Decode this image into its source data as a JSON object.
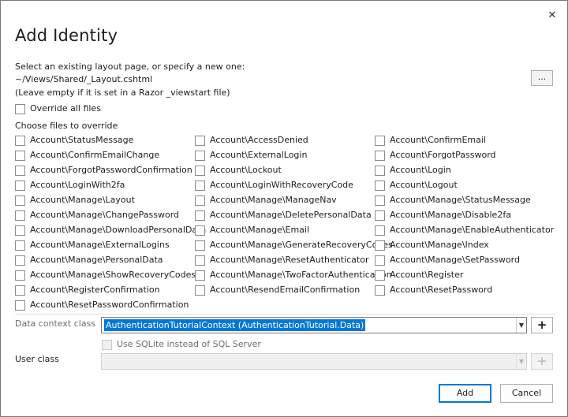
{
  "dialog": {
    "title": "Add Identity",
    "close_glyph": "✕"
  },
  "layout": {
    "prompt": "Select an existing layout page, or specify a new one:",
    "path": "~/Views/Shared/_Layout.cshtml",
    "hint": "(Leave empty if it is set in a Razor _viewstart file)",
    "browse_label": "..."
  },
  "override_all": {
    "label": "Override all files",
    "checked": false
  },
  "choose_files_label": "Choose files to override",
  "files": {
    "col1": [
      "Account\\StatusMessage",
      "Account\\ConfirmEmailChange",
      "Account\\ForgotPasswordConfirmation",
      "Account\\LoginWith2fa",
      "Account\\Manage\\Layout",
      "Account\\Manage\\ChangePassword",
      "Account\\Manage\\DownloadPersonalData",
      "Account\\Manage\\ExternalLogins",
      "Account\\Manage\\PersonalData",
      "Account\\Manage\\ShowRecoveryCodes",
      "Account\\RegisterConfirmation",
      "Account\\ResetPasswordConfirmation"
    ],
    "col2": [
      "Account\\AccessDenied",
      "Account\\ExternalLogin",
      "Account\\Lockout",
      "Account\\LoginWithRecoveryCode",
      "Account\\Manage\\ManageNav",
      "Account\\Manage\\DeletePersonalData",
      "Account\\Manage\\Email",
      "Account\\Manage\\GenerateRecoveryCodes",
      "Account\\Manage\\ResetAuthenticator",
      "Account\\Manage\\TwoFactorAuthentication",
      "Account\\ResendEmailConfirmation"
    ],
    "col3": [
      "Account\\ConfirmEmail",
      "Account\\ForgotPassword",
      "Account\\Login",
      "Account\\Logout",
      "Account\\Manage\\StatusMessage",
      "Account\\Manage\\Disable2fa",
      "Account\\Manage\\EnableAuthenticator",
      "Account\\Manage\\Index",
      "Account\\Manage\\SetPassword",
      "Account\\Register",
      "Account\\ResetPassword"
    ]
  },
  "data_context": {
    "label": "Data context class",
    "value": "AuthenticationTutorialContext (AuthenticationTutorial.Data)",
    "add_label": "+"
  },
  "sqlite": {
    "label": "Use SQLite instead of SQL Server",
    "checked": false,
    "enabled": false
  },
  "user_class": {
    "label": "User class",
    "value": "",
    "add_label": "+"
  },
  "buttons": {
    "add": "Add",
    "cancel": "Cancel"
  },
  "colors": {
    "selection": "#0078d7",
    "border": "#7a7a7a"
  }
}
